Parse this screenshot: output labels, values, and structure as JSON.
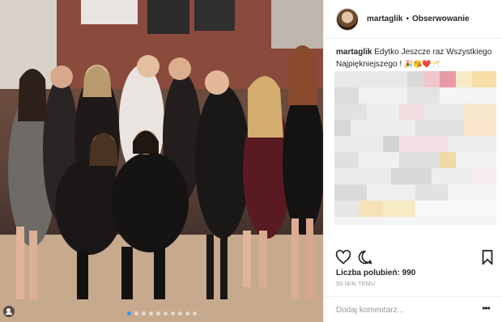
{
  "post": {
    "username": "martaglik",
    "separator": "•",
    "follow_label": "Obserwowanie",
    "caption_user": "martaglik",
    "caption_text": "Edytko Jeszcze raz Wszystkiego Najpiękniejszego ! ",
    "caption_emoji": "🎉😘❤️🥂",
    "likes_text": "Liczba polubień: 990",
    "time_text": "50 MIN TEMU",
    "comment_placeholder": "Dodaj komentarz...",
    "more_glyph": "•••"
  },
  "photo": {
    "carousel_count": 10,
    "active_index": 0
  },
  "icons": {
    "like": "heart-icon",
    "comment": "speech-bubble-icon",
    "save": "bookmark-icon",
    "more": "ellipsis-icon",
    "multi": "user-tag-icon"
  },
  "colors": {
    "text": "#262626",
    "muted": "#999999",
    "divider": "#efefef",
    "accent": "#3897f0"
  }
}
